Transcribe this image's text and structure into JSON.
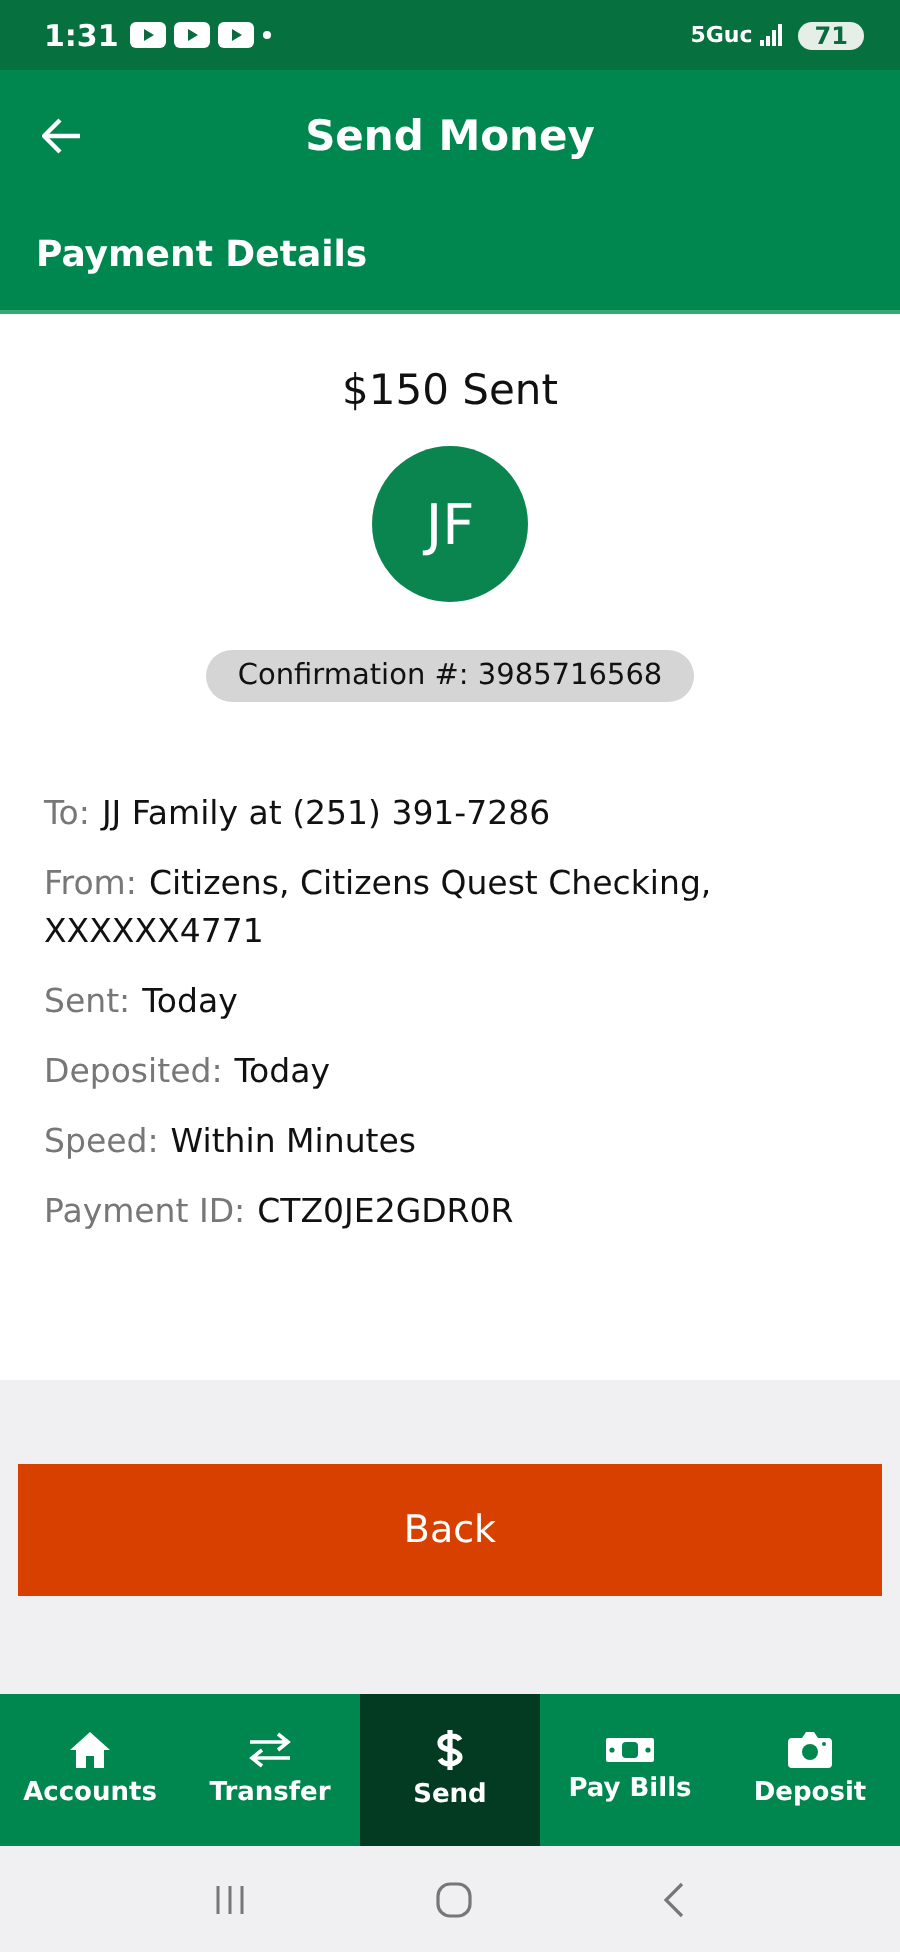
{
  "status_bar": {
    "time": "1:31",
    "network": "5Guc",
    "battery": "71"
  },
  "header": {
    "title": "Send Money"
  },
  "section": {
    "title": "Payment Details"
  },
  "summary": {
    "amount": "$150 Sent",
    "avatar": "JF",
    "confirmation": "Confirmation #: 3985716568"
  },
  "details": [
    {
      "label": "To:",
      "value": "JJ Family at (251) 391-7286"
    },
    {
      "label": "From:",
      "value": "Citizens, Citizens Quest Checking, XXXXXX4771"
    },
    {
      "label": "Sent:",
      "value": "Today"
    },
    {
      "label": "Deposited:",
      "value": "Today"
    },
    {
      "label": "Speed:",
      "value": "Within Minutes"
    },
    {
      "label": "Payment ID:",
      "value": "CTZ0JE2GDR0R"
    }
  ],
  "back_button": "Back",
  "nav": [
    {
      "label": "Accounts",
      "selected": false
    },
    {
      "label": "Transfer",
      "selected": false
    },
    {
      "label": "Send",
      "selected": true
    },
    {
      "label": "Pay Bills",
      "selected": false
    },
    {
      "label": "Deposit",
      "selected": false
    }
  ]
}
